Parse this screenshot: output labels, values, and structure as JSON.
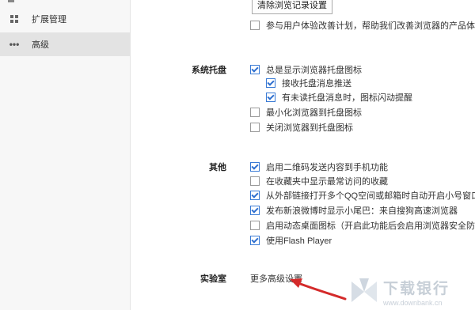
{
  "sidebar": {
    "items": [
      {
        "label": "扩展管理",
        "icon": "extensions-icon"
      },
      {
        "label": "高级",
        "icon": "more-dots-icon",
        "active": true
      }
    ]
  },
  "top_button": {
    "label": "清除浏览记录设置"
  },
  "top_option": {
    "label": "参与用户体验改善计划，帮助我们改善浏览器的产品体验",
    "checked": false
  },
  "tray": {
    "title": "系统托盘",
    "options": [
      {
        "label": "总是显示浏览器托盘图标",
        "checked": true
      },
      {
        "label": "接收托盘消息推送",
        "checked": true
      },
      {
        "label": "有未读托盘消息时，图标闪动提醒",
        "checked": true
      },
      {
        "label": "最小化浏览器到托盘图标",
        "checked": false
      },
      {
        "label": "关闭浏览器到托盘图标",
        "checked": false
      }
    ]
  },
  "other": {
    "title": "其他",
    "options": [
      {
        "label": "启用二维码发送内容到手机功能",
        "checked": true
      },
      {
        "label": "在收藏夹中显示最常访问的收藏",
        "checked": false
      },
      {
        "label": "从外部链接打开多个QQ空间或邮箱时自动开启小号窗口",
        "checked": true
      },
      {
        "label": "发布新浪微博时显示小尾巴：来自搜狗高速浏览器",
        "checked": true
      },
      {
        "label": "启用动态桌面图标（开启此功能后会启用浏览器安全防护机",
        "checked": false
      },
      {
        "label": "使用Flash Player",
        "checked": true
      }
    ]
  },
  "lab": {
    "title": "实验室",
    "link": "更多高级设置"
  },
  "watermark": {
    "cn": "下载银行",
    "en": "www.downbank.cn"
  },
  "colors": {
    "accent": "#2e6fcf",
    "arrow": "#d42a2a",
    "sidebar_active": "#e3e3e3"
  }
}
